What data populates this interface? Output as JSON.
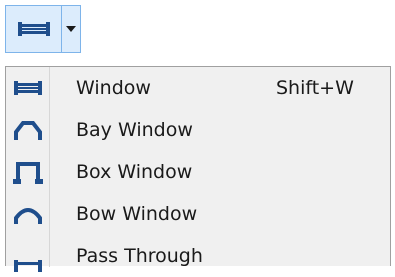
{
  "toolbar": {
    "split_button_icon": "window-icon",
    "dropdown_icon": "chevron-down-icon"
  },
  "menu": {
    "items": [
      {
        "icon": "window-icon",
        "label": "Window",
        "shortcut": "Shift+W"
      },
      {
        "icon": "bay-window-icon",
        "label": "Bay Window",
        "shortcut": ""
      },
      {
        "icon": "box-window-icon",
        "label": "Box Window",
        "shortcut": ""
      },
      {
        "icon": "bow-window-icon",
        "label": "Bow Window",
        "shortcut": ""
      },
      {
        "icon": "pass-through-icon",
        "label": "Pass Through",
        "shortcut": ""
      }
    ]
  },
  "colors": {
    "icon_blue": "#1f4e8c",
    "highlight_fill": "#dcecfc",
    "highlight_border": "#7eb4ea",
    "menu_background": "#f0f0f0"
  }
}
